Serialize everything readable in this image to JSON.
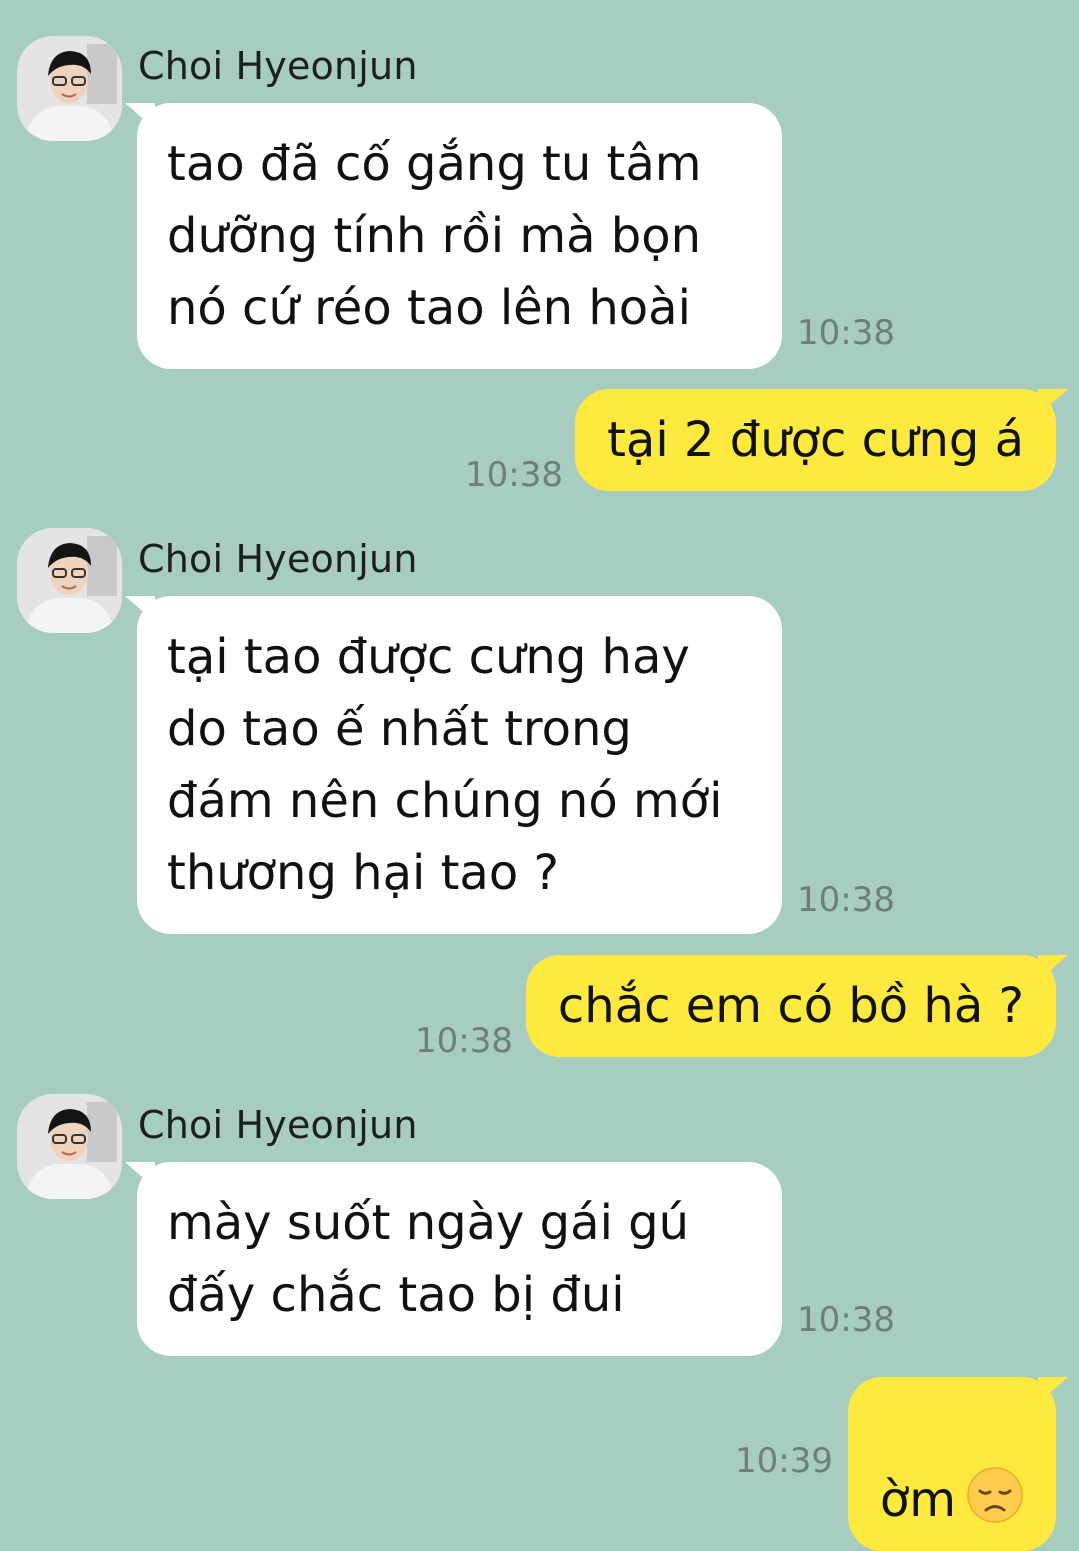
{
  "sender_name": "Choi Hyeonjun",
  "messages": [
    {
      "type": "in",
      "text": "tao đã cố gắng tu tâm\ndưỡng tính rồi mà bọn\nnó cứ réo tao lên hoài",
      "time": "10:38"
    },
    {
      "type": "out",
      "text": "tại 2 được cưng á",
      "time": "10:38"
    },
    {
      "type": "in",
      "text": "tại tao được cưng hay\ndo tao ế nhất trong\nđám nên chúng nó mới\nthương hại tao ?",
      "time": "10:38"
    },
    {
      "type": "out",
      "text": "chắc em có bồ hà ?",
      "time": "10:38"
    },
    {
      "type": "in",
      "text": "mày suốt ngày gái gú\nđấy chắc tao bị đui",
      "time": "10:38"
    },
    {
      "type": "out",
      "text": "ờm",
      "emoji": "disappointed-face-emoji",
      "time": "10:39"
    }
  ],
  "colors": {
    "background": "#a6cdc0",
    "incoming_bubble": "#ffffff",
    "outgoing_bubble": "#fee93f",
    "timestamp": "#6d7f79"
  }
}
